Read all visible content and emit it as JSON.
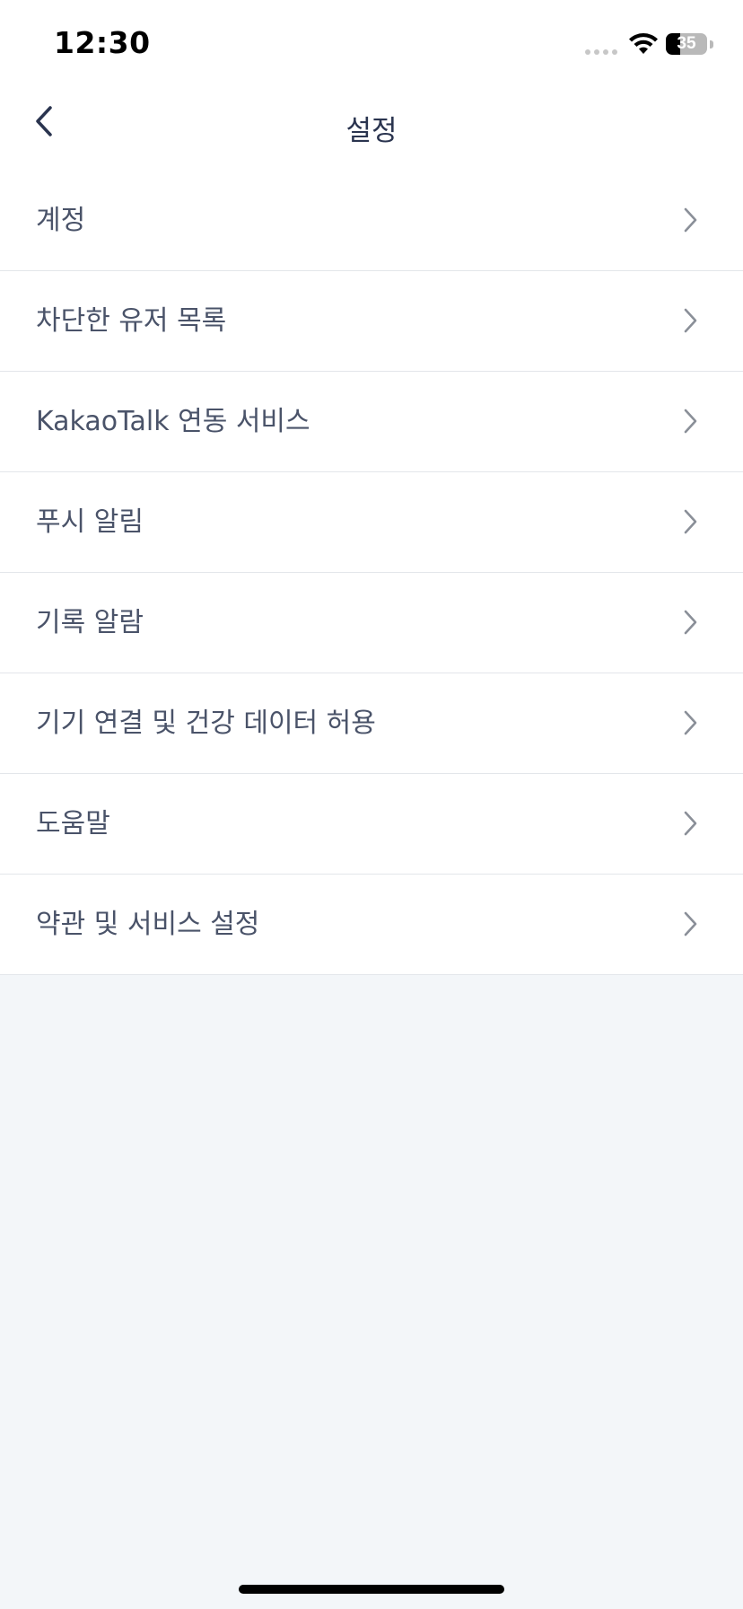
{
  "status_bar": {
    "time": "12:30",
    "battery_level": "35",
    "battery_fraction": 0.35,
    "icons": [
      "cellular-signal-icon",
      "wifi-icon",
      "battery-icon"
    ]
  },
  "nav": {
    "title": "설정",
    "back_icon": "chevron-left-icon"
  },
  "menu": {
    "items": [
      {
        "label": "계정",
        "icon": "chevron-right-icon"
      },
      {
        "label": "차단한 유저 목록",
        "icon": "chevron-right-icon"
      },
      {
        "label": "KakaoTalk 연동 서비스",
        "icon": "chevron-right-icon"
      },
      {
        "label": "푸시 알림",
        "icon": "chevron-right-icon"
      },
      {
        "label": "기록 알람",
        "icon": "chevron-right-icon"
      },
      {
        "label": "기기 연결 및 건강 데이터 허용",
        "icon": "chevron-right-icon"
      },
      {
        "label": "도움말",
        "icon": "chevron-right-icon"
      },
      {
        "label": "약관 및 서비스 설정",
        "icon": "chevron-right-icon"
      }
    ]
  },
  "colors": {
    "background": "#f3f6f9",
    "surface": "#ffffff",
    "title_text": "#2a344f",
    "item_text": "#4a5369",
    "chevron": "#8a8f98",
    "divider": "#e3e6ea"
  }
}
